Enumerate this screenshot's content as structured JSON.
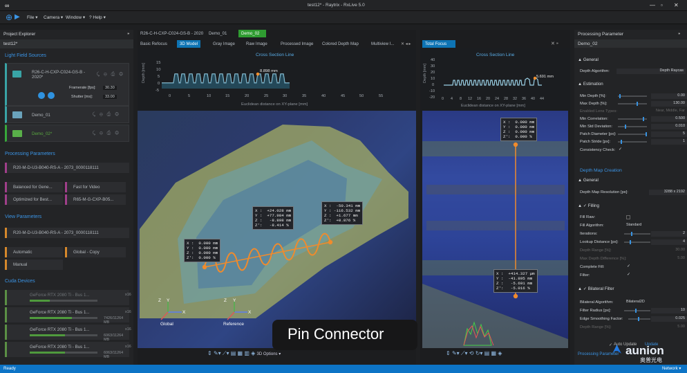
{
  "window": {
    "title": "test12* - Raytrix - RxLive 5.0"
  },
  "menu": {
    "items": [
      "File ▾",
      "Camera ▾",
      "Window ▾",
      "? Help ▾"
    ]
  },
  "project_explorer": {
    "title": "Project Explorer",
    "project": "test12*",
    "lightfield_sources": "Light Field Sources",
    "camera": {
      "name": "R26-C-H-CXP-C024-GS-B - 2020*",
      "framerate_label": "Framerate [fps]:",
      "framerate": "30.30",
      "shutter_label": "Shutter [ms]:",
      "shutter": "33.00"
    },
    "sources": [
      "Demo_01",
      "Demo_02*"
    ],
    "processing_parameters": "Processing Parameters",
    "pp_items": [
      "R20-M-D-U3-B040-RS-A - 2073_0000118111",
      "Balanced for Gene...",
      "Fast for Video",
      "Optimized for Best...",
      "R65-M-G-CXP-B05..."
    ],
    "view_parameters": "View Parameters",
    "vp_items": [
      "R20-M-D-U3-B040-RS-A - 2073_0000118111",
      "Automatic",
      "Global - Copy",
      "Manual"
    ],
    "cuda_devices": "Cuda Devices",
    "gpus": [
      {
        "name": "GeForce RTX 2080 Ti - Bus 1...",
        "load": "x16",
        "mem": ""
      },
      {
        "name": "GeForce RTX 2080 Ti - Bus 1...",
        "load": "x16",
        "mem": "7426/11264 MB"
      },
      {
        "name": "GeForce RTX 2080 Ti - Bus 1...",
        "load": "x16",
        "mem": "6063/11264 MB"
      },
      {
        "name": "GeForce RTX 2080 Ti - Bus 1...",
        "load": "x16",
        "mem": "6063/11264 MB"
      }
    ]
  },
  "left_view": {
    "file_tabs": [
      "R26-C-H-CXP-C024-GS-B - 2020",
      "Demo_01",
      "Demo_02"
    ],
    "view_tabs": [
      "Basic Refocus",
      "3D Model",
      "Gray Image",
      "Raw Image",
      "Processed Image",
      "Colored Depth Map",
      "Multiview I..."
    ],
    "cross_title": "Cross Section Line",
    "x_label": "Euclidean distance on XY-plane [mm]",
    "y_label": "Depth [mm]",
    "peak_label": "8.898 mm",
    "annot_left": "X :  0.000 mm\nY :  0.000 mm\nZ :  0.000 mm\nZ':  0.000 %",
    "annot_center": "X :  +24.028 mm\nY :  +77.984 mm\nZ :   -8.898 mm\nZ':   -8.414 %",
    "annot_right": "X :  -50.341 mm\nY : -116.532 mm\nZ :  +1.677 mm\nZ':  +0.876 %",
    "axes_left": "Global",
    "axes_right": "Reference",
    "caption": "Pin Connector",
    "toolbar_option": "3D Options ▾",
    "chart": {
      "type": "line",
      "x": [
        0,
        5,
        10,
        15,
        20,
        25,
        30,
        35,
        40,
        45,
        50,
        55
      ],
      "y_ticks": [
        -5,
        0,
        5,
        10,
        15
      ],
      "x_ticks": [
        0,
        5,
        10,
        15,
        20,
        25,
        30,
        35,
        40,
        45,
        50,
        55
      ],
      "peaks": 15
    }
  },
  "right_view": {
    "tab": "Total Focus",
    "cross_title": "Cross Section Line",
    "x_label": "Euclidean distance on XY-plane [mm]",
    "y_label": "Depth [mm]",
    "peak_label": "5.691 mm",
    "annot_top": "X :  0.000 mm\nY :  0.000 mm\nZ :  0.000 mm\nZ':  0.000 %",
    "annot_bottom": "X :  +414.327 µm\nY :  -41.895 mm\nZ :   -5.691 mm\nZ':   -5.016 %",
    "chart": {
      "type": "line",
      "x_ticks": [
        0,
        4,
        8,
        12,
        16,
        20,
        24,
        28,
        32,
        36,
        40,
        44
      ],
      "y_ticks": [
        -20,
        -10,
        0,
        10,
        20,
        30,
        40
      ]
    }
  },
  "processing_params": {
    "title": "Processing Parameter",
    "demo": "Demo_02",
    "sections": {
      "general": "▲ General",
      "estimation": "▲ Estimation",
      "depth_map_creation": "Depth Map Creation",
      "filling": "▲ ✓ Filling",
      "bilateral": "▲ ✓ Bilateral Filter"
    },
    "depth_algorithm_label": "Depth Algorithm:",
    "depth_algorithm": "Depth Raycas",
    "estimation_rows": [
      {
        "label": "Min Depth [%]:",
        "value": "0.00"
      },
      {
        "label": "Max Depth [%]:",
        "value": "130.00"
      },
      {
        "label": "Enabled Lens Types:",
        "value": "Near, Middle, Far"
      },
      {
        "label": "Min Correlation:",
        "value": "0.500"
      },
      {
        "label": "Min Std Deviation:",
        "value": "0.010"
      },
      {
        "label": "Patch Diameter [px]:",
        "value": "5"
      },
      {
        "label": "Patch Stride [px]:",
        "value": "1"
      },
      {
        "label": "Consistency Check:",
        "value": "✓"
      }
    ],
    "dm_resolution_label": "Depth Map Resolution [px]:",
    "dm_resolution": "3288 x 2192",
    "filling_rows": [
      {
        "label": "Fill Raw:",
        "value": ""
      },
      {
        "label": "Fill Algorithm:",
        "value": "Standard"
      },
      {
        "label": "Iterations:",
        "value": "2"
      },
      {
        "label": "Lookup Distance [px]:",
        "value": "4"
      },
      {
        "label": "Depth Range [%]:",
        "value": "30.00"
      },
      {
        "label": "Max Depth Difference [%]:",
        "value": "5.00"
      },
      {
        "label": "Complete Fill:",
        "value": "✓"
      },
      {
        "label": "Filter:",
        "value": "✓"
      }
    ],
    "bilateral_rows": [
      {
        "label": "Bilateral Algorithm:",
        "value": "Bilateral2D"
      },
      {
        "label": "Filter Radius [px]:",
        "value": "10"
      },
      {
        "label": "Edge Smoothing Factor:",
        "value": "0.025"
      },
      {
        "label": "Depth Range [%]:",
        "value": "5.00"
      }
    ],
    "auto_update": "Auto Update",
    "update": "Update",
    "footer_tab": "Processing Parameter",
    "brand": "aunion",
    "brand_cn": "奥普光电"
  },
  "status": {
    "left": "Ready",
    "right": "Network ▾"
  }
}
